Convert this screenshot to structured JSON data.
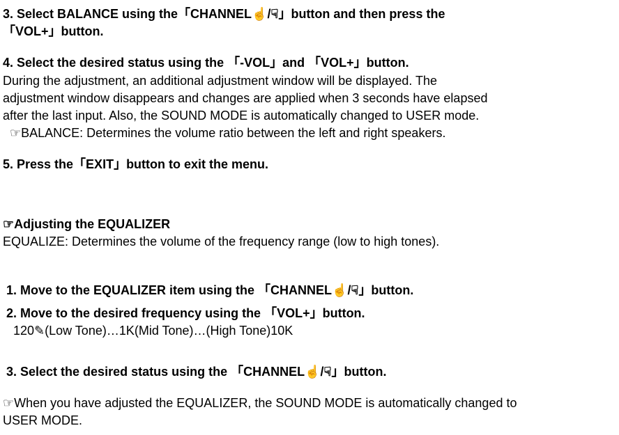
{
  "step3": {
    "line1": "3. Select BALANCE using the「CHANNEL",
    "iconA": "☝",
    "sep": "/",
    "iconB": "☟",
    "line1end": "」button and then press the",
    "line2": "「VOL+」button."
  },
  "step4": {
    "title": "4. Select the desired status using the 「-VOL」and 「VOL+」button.",
    "desc1": " During the adjustment, an additional adjustment window will be displayed. The",
    "desc2": "adjustment window disappears and changes are applied when 3 seconds have elapsed",
    "desc3": "after the last input. Also, the SOUND MODE is automatically changed to USER mode.",
    "note": "  ☞BALANCE: Determines the volume ratio between the left and right speakers."
  },
  "step5": {
    "title": "5. Press the「EXIT」button to exit the menu."
  },
  "eq": {
    "heading": "☞Adjusting the EQUALIZER",
    "sub": "EQUALIZE: Determines the volume of the frequency range (low to high tones).",
    "s1a": " 1. Move to the EQUALIZER item using the 「CHANNEL",
    "s1icon1": "☝",
    "s1sep": "/",
    "s1icon2": "☟",
    "s1end": "」button.",
    "s2": " 2. Move to the desired frequency using the 「VOL+」button.",
    "s2note": "   120✎(Low Tone)…1K(Mid Tone)…(High Tone)10K",
    "s3a": " 3. Select the desired status using the 「CHANNEL",
    "s3icon1": "☝",
    "s3sep": "/",
    "s3icon2": "☟",
    "s3end": "」button.",
    "footer1": "☞When you have adjusted the EQUALIZER, the SOUND MODE is automatically changed to",
    "footer2": "USER MODE."
  }
}
